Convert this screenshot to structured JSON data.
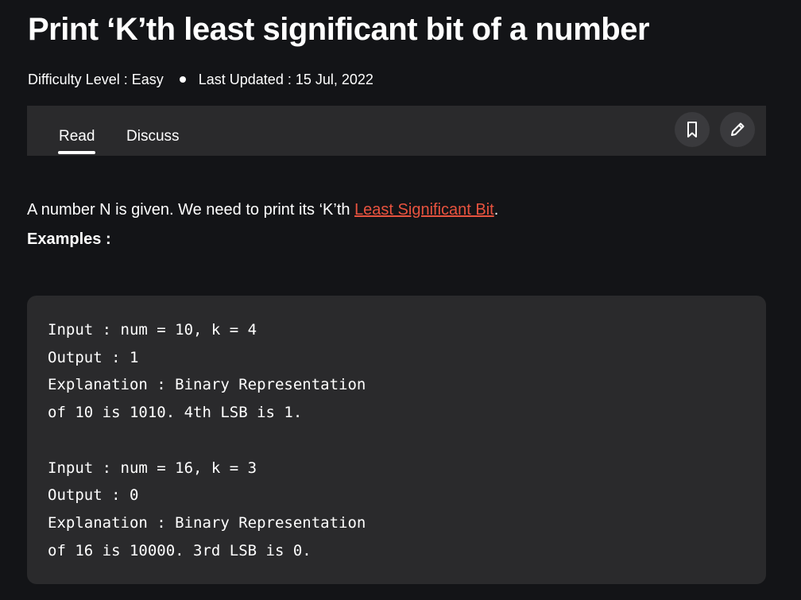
{
  "article": {
    "title": "Print ‘K’th least significant bit of a number",
    "difficulty": "Difficulty Level : Easy",
    "last_updated": "Last Updated : 15 Jul, 2022"
  },
  "tabs": {
    "read": "Read",
    "discuss": "Discuss"
  },
  "toolbar": {
    "bookmark_icon": "bookmark-icon",
    "edit_icon": "pencil-icon"
  },
  "content": {
    "intro_prefix": "A number N is given. We need to print its ‘K’th ",
    "intro_link": "Least Significant Bit",
    "intro_suffix": ".",
    "examples_label": "Examples :",
    "code_lines": [
      "Input : num = 10, k = 4",
      "Output : 1",
      "Explanation : Binary Representation",
      "of 10 is 1010. 4th LSB is 1.",
      "Input : num = 16, k = 3",
      "Output : 0",
      "Explanation : Binary Representation",
      "of 16 is 10000. 3rd LSB is 0."
    ]
  },
  "colors": {
    "background": "#131417",
    "panel": "#2a2a2c",
    "link": "#e8533f"
  }
}
